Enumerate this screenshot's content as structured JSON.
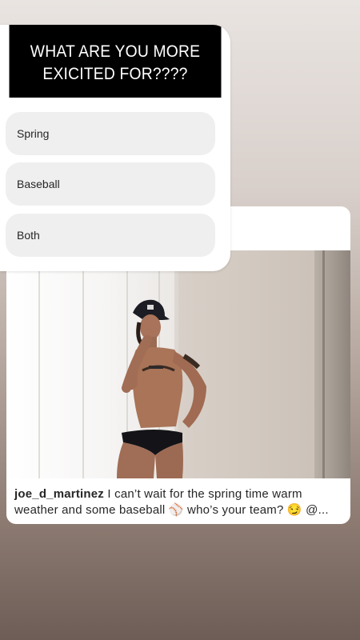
{
  "poll": {
    "question": "WHAT ARE YOU MORE EXICITED FOR????",
    "options": [
      "Spring",
      "Baseball",
      "Both"
    ]
  },
  "post": {
    "username": "joe_d_martinez",
    "caption": "I can’t wait for the spring time warm weather and some baseball ⚾ who’s your team? 😏 @..."
  }
}
